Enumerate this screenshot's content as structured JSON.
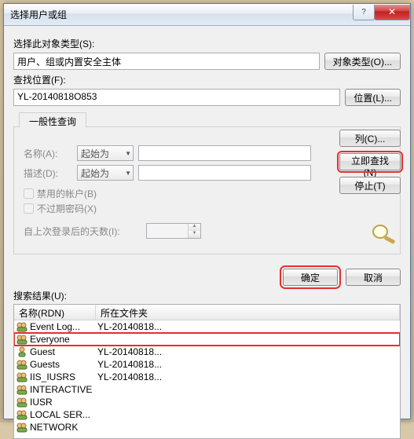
{
  "titlebar": {
    "title": "选择用户或组"
  },
  "section1": {
    "type_label": "选择此对象类型(S):",
    "type_value": "用户、组或内置安全主体",
    "type_btn": "对象类型(O)...",
    "loc_label": "查找位置(F):",
    "loc_value": "YL-20140818O853",
    "loc_btn": "位置(L)..."
  },
  "group": {
    "tab": "一般性查询",
    "name_label": "名称(A):",
    "name_combo": "起始为",
    "desc_label": "描述(D):",
    "desc_combo": "起始为",
    "chk1": "禁用的帐户(B)",
    "chk2": "不过期密码(X)",
    "days_label": "自上次登录后的天数(I):"
  },
  "rightcol": {
    "columns_btn": "列(C)...",
    "find_btn": "立即查找(N)",
    "stop_btn": "停止(T)"
  },
  "footer": {
    "ok": "确定",
    "cancel": "取消"
  },
  "results": {
    "label": "搜索结果(U):",
    "col1": "名称(RDN)",
    "col2": "所在文件夹",
    "rows": [
      {
        "name": "Event Log...",
        "folder": "YL-20140818..."
      },
      {
        "name": "Everyone",
        "folder": ""
      },
      {
        "name": "Guest",
        "folder": "YL-20140818..."
      },
      {
        "name": "Guests",
        "folder": "YL-20140818..."
      },
      {
        "name": "IIS_IUSRS",
        "folder": "YL-20140818..."
      },
      {
        "name": "INTERACTIVE",
        "folder": ""
      },
      {
        "name": "IUSR",
        "folder": ""
      },
      {
        "name": "LOCAL SER...",
        "folder": ""
      },
      {
        "name": "NETWORK",
        "folder": ""
      }
    ]
  }
}
